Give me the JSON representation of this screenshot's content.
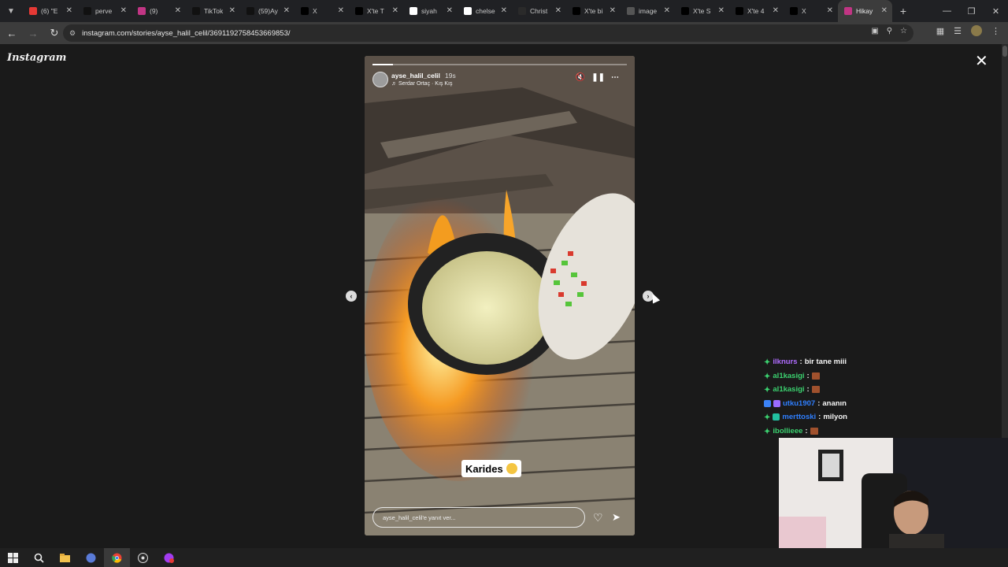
{
  "browser": {
    "tabs": [
      {
        "title": "(6) \"E",
        "favicon": "youtube-icon",
        "color": "#e53935",
        "active": false
      },
      {
        "title": "perve",
        "favicon": "tiktok-icon",
        "color": "#111111",
        "active": false
      },
      {
        "title": "(9)",
        "favicon": "instagram-icon",
        "color": "#c13584",
        "active": false
      },
      {
        "title": "TikTok",
        "favicon": "tiktok-icon",
        "color": "#111111",
        "active": false
      },
      {
        "title": "(59)Ay",
        "favicon": "tiktok-icon",
        "color": "#111111",
        "active": false
      },
      {
        "title": "X",
        "favicon": "x-icon",
        "color": "#000000",
        "active": false
      },
      {
        "title": "X'te T",
        "favicon": "x-icon",
        "color": "#000000",
        "active": false
      },
      {
        "title": "siyah",
        "favicon": "google-icon",
        "color": "#ffffff",
        "active": false
      },
      {
        "title": "chelse",
        "favicon": "google-icon",
        "color": "#ffffff",
        "active": false
      },
      {
        "title": "Christ",
        "favicon": "site-icon",
        "color": "#2a2a2a",
        "active": false
      },
      {
        "title": "X'te bi",
        "favicon": "x-icon",
        "color": "#000000",
        "active": false
      },
      {
        "title": "image",
        "favicon": "globe-icon",
        "color": "#555555",
        "active": false
      },
      {
        "title": "X'te S",
        "favicon": "x-icon",
        "color": "#000000",
        "active": false
      },
      {
        "title": "X'te 4",
        "favicon": "x-icon",
        "color": "#000000",
        "active": false
      },
      {
        "title": "X",
        "favicon": "x-icon",
        "color": "#000000",
        "active": false
      },
      {
        "title": "Hikay",
        "favicon": "instagram-icon",
        "color": "#c13584",
        "active": true
      }
    ],
    "url": "instagram.com/stories/ayse_halil_celil/3691192758453669853/"
  },
  "instagram": {
    "logo": "Instagram",
    "story": {
      "username": "ayse_halil_celil",
      "time": "19s",
      "music": "Serdar Ortaç · Kış Kış",
      "caption": "Karides",
      "reply_placeholder": "ayse_halil_celil'e yanıt ver...",
      "progress": 0.08
    }
  },
  "chat": [
    {
      "user": "ilknurs",
      "msg": "bir tane miii",
      "color": "#b06cff",
      "badge": "star",
      "emote": false
    },
    {
      "user": "al1kasigi",
      "msg": "",
      "color": "#3bd16f",
      "badge": "star",
      "emote": true
    },
    {
      "user": "al1kasigi",
      "msg": "",
      "color": "#3bd16f",
      "badge": "star",
      "emote": true
    },
    {
      "user": "utku1907",
      "msg": "ananın",
      "color": "#2f7fff",
      "badge": "squares",
      "emote": false
    },
    {
      "user": "merttoski",
      "msg": "milyon",
      "color": "#2f7fff",
      "badge": "star-square",
      "emote": false
    },
    {
      "user": "ibollieee",
      "msg": "",
      "color": "#3bd16f",
      "badge": "star",
      "emote": true
    }
  ],
  "colors": {
    "accent": "#3bd16f",
    "instagram": "#c13584"
  }
}
